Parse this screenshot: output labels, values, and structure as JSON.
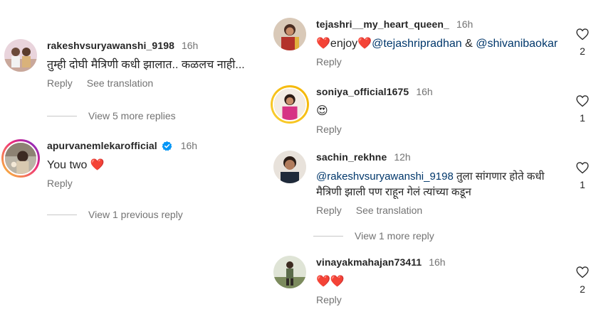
{
  "left": {
    "comment1": {
      "username": "rakeshvsuryawanshi_9198",
      "time": "16h",
      "text": "तुम्ही दोघी मैत्रिणी कधी झालात.. कळलच नाही...",
      "reply": "Reply",
      "translate": "See translation"
    },
    "view_more_1": "View 5 more replies",
    "comment2": {
      "username": "apurvanemlekarofficial",
      "time": "16h",
      "text": "You two",
      "emoji": "❤️",
      "reply": "Reply"
    },
    "view_previous": "View 1 previous reply"
  },
  "right": {
    "comment1": {
      "username": "tejashri__my_heart_queen_",
      "time": "16h",
      "emoji_left": "❤️",
      "text_word": "enjoy",
      "emoji_right": "❤️",
      "mention1": "@tejashripradhan",
      "amp": " & ",
      "mention2": "@shivanibaokar",
      "reply": "Reply",
      "likes": "2"
    },
    "comment2": {
      "username": "soniya_official1675",
      "time": "16h",
      "text": "😍",
      "reply": "Reply",
      "likes": "1"
    },
    "comment3": {
      "username": "sachin_rekhne",
      "time": "12h",
      "mention": "@rakeshvsuryawanshi_9198",
      "text_line1": " तुला सांगणार होते कधी",
      "text_line2": "मैत्रिणी झाली पण राहून गेलं त्यांच्या कडून",
      "reply": "Reply",
      "translate": "See translation",
      "likes": "1"
    },
    "view_more": "View 1 more reply",
    "comment4": {
      "username": "vinayakmahajan73411",
      "time": "16h",
      "text": "❤️❤️",
      "reply": "Reply",
      "likes": "2"
    }
  },
  "colors": {
    "text": "#262626",
    "secondary": "#737373",
    "mention": "#00376b",
    "heart": "#ed4956",
    "verified": "#0095f6"
  }
}
